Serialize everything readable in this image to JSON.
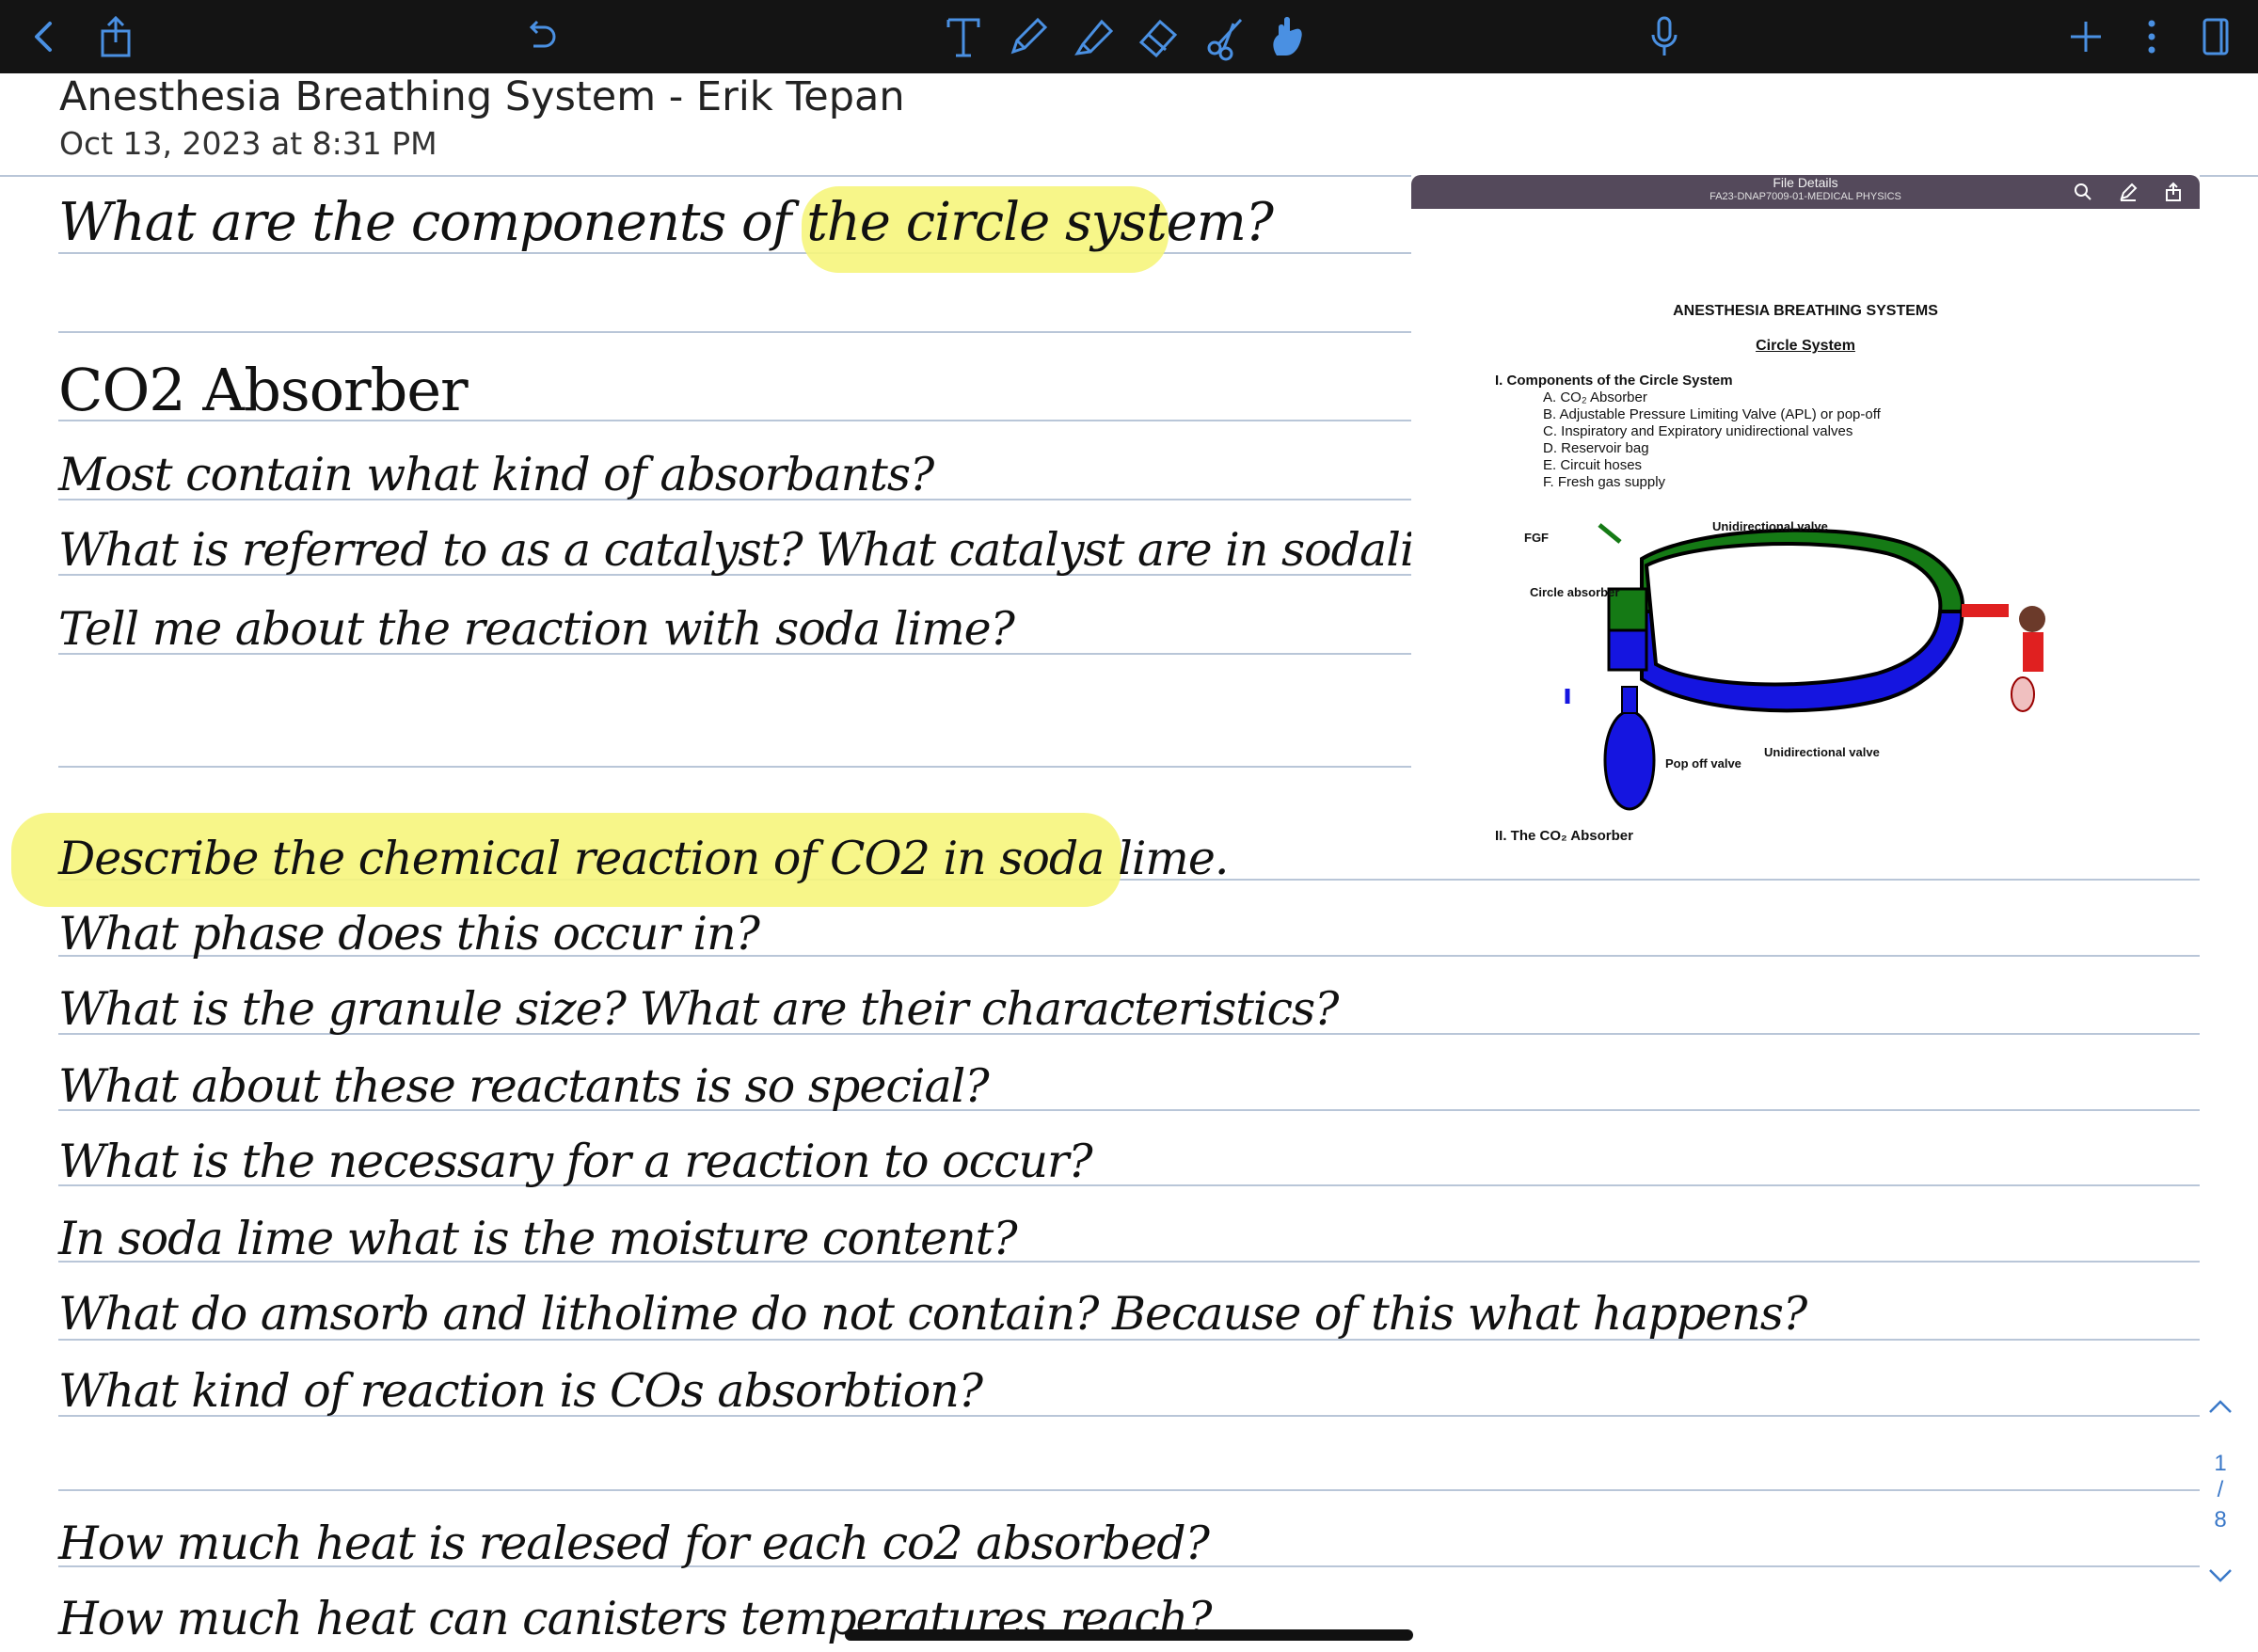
{
  "toolbar": {
    "icons": [
      "back-icon",
      "share-icon",
      "undo-icon",
      "text-tool-icon",
      "pen-icon",
      "highlighter-icon",
      "eraser-icon",
      "scissors-icon",
      "hand-icon",
      "microphone-icon",
      "add-page-icon",
      "more-icon",
      "page-view-icon"
    ],
    "accent": "#4a90e2",
    "background": "#141414"
  },
  "note": {
    "title": "Anesthesia Breathing System - Erik Tepan",
    "date": "Oct 13, 2023 at 8:31 PM"
  },
  "handwriting": {
    "q_title_a": "What are the components of the ",
    "q_title_b": "circle system?",
    "heading": "CO2 Absorber",
    "lines_top": [
      "Most contain what kind of absorbants?",
      "What is referred to as a catalyst? What catalyst are in sodalime?",
      "Tell me about the reaction with soda lime?"
    ],
    "describe": "Describe the chemical reaction of CO2 in soda lime.",
    "lines_mid": [
      "What phase does this occur in?",
      "What is the granule size? What are their characteristics?",
      "What about these reactants is so special?",
      "What is the necessary for a reaction to occur?",
      "In soda lime what is the moisture content?",
      "What do amsorb and litholime do not contain? Because of this what happens?",
      "What kind of reaction is COs absorbtion?"
    ],
    "lines_bottom": [
      "How much heat is realesed  for each co2 absorbed?",
      "How much heat can canisters temperatures reach?"
    ],
    "highlight_color": "#f6f57c"
  },
  "pdf_panel": {
    "bar_title": "File Details",
    "bar_subtitle": "FA23-DNAP7009-01-MEDICAL PHYSICS",
    "doc_title": "ANESTHESIA BREATHING SYSTEMS",
    "doc_subtitle": "Circle System",
    "section1": "I.  Components of the Circle System",
    "components": [
      "A.  CO₂ Absorber",
      "B.  Adjustable Pressure Limiting Valve (APL) or pop-off",
      "C.  Inspiratory and Expiratory unidirectional valves",
      "D.  Reservoir bag",
      "E.  Circuit hoses",
      "F.  Fresh gas supply"
    ],
    "diagram_labels": {
      "fgf": "FGF",
      "uni_top": "Unidirectional valve",
      "absorber": "Circle absorber",
      "uni_bottom": "Unidirectional valve",
      "popoff": "Pop off valve"
    },
    "section2": "II.  The CO₂ Absorber"
  },
  "pager": {
    "current": "1",
    "separator": "/",
    "total": "8"
  }
}
